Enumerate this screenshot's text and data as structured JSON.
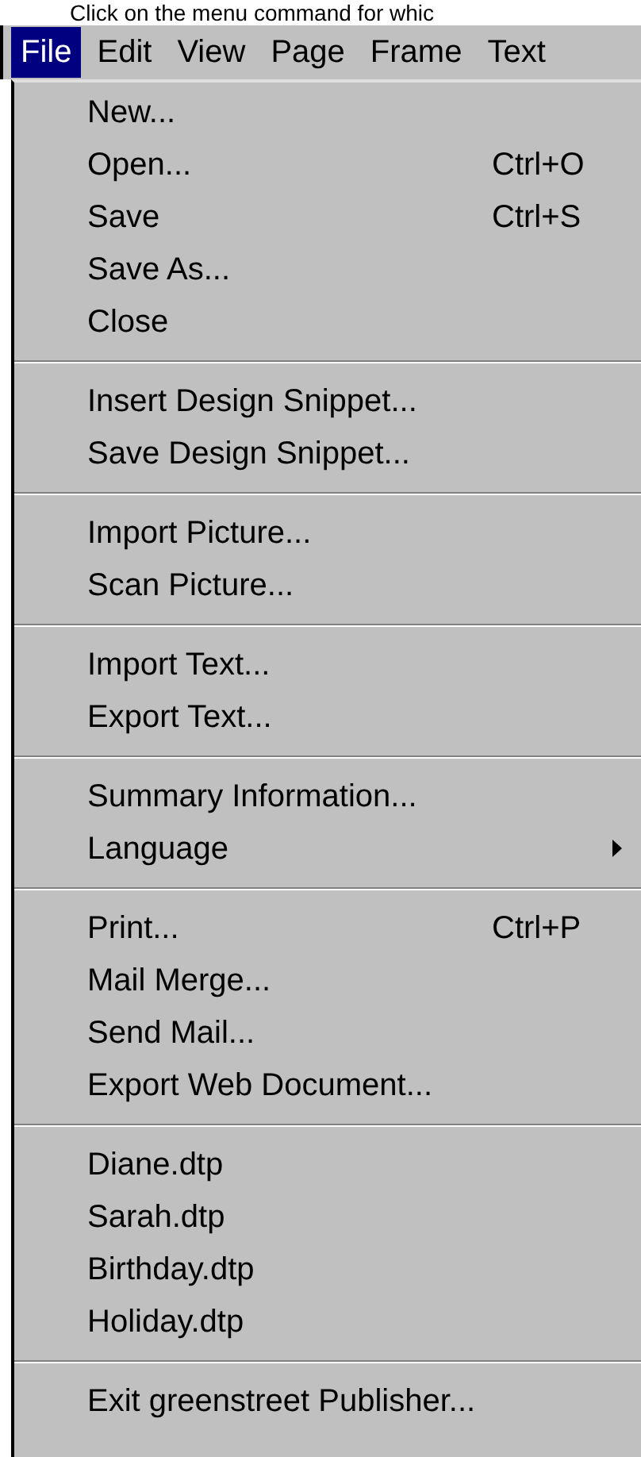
{
  "instruction": "Click on the menu command for whic",
  "menubar": [
    {
      "label": "File",
      "selected": true
    },
    {
      "label": "Edit",
      "selected": false
    },
    {
      "label": "View",
      "selected": false
    },
    {
      "label": "Page",
      "selected": false
    },
    {
      "label": "Frame",
      "selected": false
    },
    {
      "label": "Text",
      "selected": false
    }
  ],
  "menu": {
    "items": [
      {
        "kind": "item",
        "label": "New..."
      },
      {
        "kind": "item",
        "label": "Open...",
        "shortcut": "Ctrl+O"
      },
      {
        "kind": "item",
        "label": "Save",
        "shortcut": "Ctrl+S"
      },
      {
        "kind": "item",
        "label": "Save As..."
      },
      {
        "kind": "item",
        "label": "Close"
      },
      {
        "kind": "separator"
      },
      {
        "kind": "item",
        "label": "Insert Design Snippet..."
      },
      {
        "kind": "item",
        "label": "Save Design Snippet..."
      },
      {
        "kind": "separator"
      },
      {
        "kind": "item",
        "label": "Import Picture..."
      },
      {
        "kind": "item",
        "label": "Scan Picture..."
      },
      {
        "kind": "separator"
      },
      {
        "kind": "item",
        "label": "Import Text..."
      },
      {
        "kind": "item",
        "label": "Export Text..."
      },
      {
        "kind": "separator"
      },
      {
        "kind": "item",
        "label": "Summary Information..."
      },
      {
        "kind": "submenu",
        "label": "Language"
      },
      {
        "kind": "separator"
      },
      {
        "kind": "item",
        "label": "Print...",
        "shortcut": "Ctrl+P"
      },
      {
        "kind": "item",
        "label": "Mail Merge..."
      },
      {
        "kind": "item",
        "label": "Send Mail..."
      },
      {
        "kind": "item",
        "label": "Export Web Document..."
      },
      {
        "kind": "separator"
      },
      {
        "kind": "item",
        "label": "Diane.dtp"
      },
      {
        "kind": "item",
        "label": "Sarah.dtp"
      },
      {
        "kind": "item",
        "label": "Birthday.dtp"
      },
      {
        "kind": "item",
        "label": "Holiday.dtp"
      },
      {
        "kind": "separator"
      },
      {
        "kind": "item",
        "label": "Exit greenstreet Publisher..."
      }
    ]
  }
}
